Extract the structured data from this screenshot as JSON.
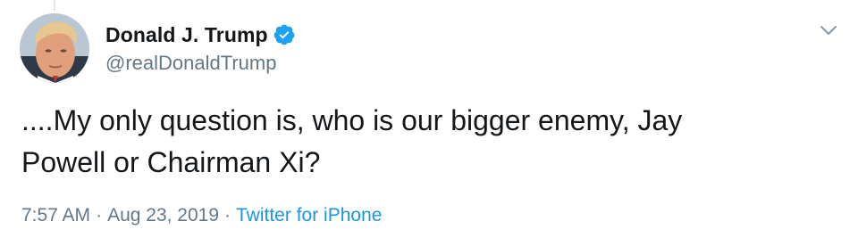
{
  "tweet": {
    "author": {
      "display_name": "Donald J. Trump",
      "handle": "@realDonaldTrump",
      "verified": true,
      "avatar_icon": "profile-photo"
    },
    "text": "....My only question is, who is our bigger enemy, Jay\nPowell or Chairman Xi?",
    "time": "7:57 AM",
    "date": "Aug 23, 2019",
    "separator": "·",
    "source": "Twitter for iPhone"
  },
  "icons": {
    "verified": "verified-badge-icon",
    "menu": "chevron-down-icon"
  },
  "colors": {
    "text_primary": "#14171a",
    "text_secondary": "#657786",
    "link": "#1b95e0",
    "verified": "#1da1f2",
    "caret": "#8899a6"
  }
}
